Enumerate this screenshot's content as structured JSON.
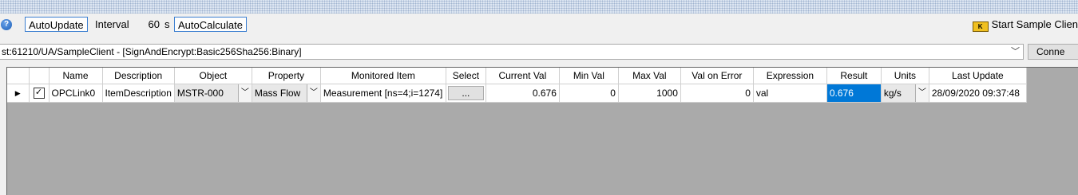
{
  "toolbar": {
    "help_icon": "?",
    "auto_update_label": "AutoUpdate",
    "interval_label": "Interval",
    "interval_value": "60",
    "interval_unit": "s",
    "auto_calculate_label": "AutoCalculate",
    "start_icon_glyph": "K",
    "start_sample_client_label": "Start Sample Clien"
  },
  "endpoint": {
    "value": "st:61210/UA/SampleClient - [SignAndEncrypt:Basic256Sha256:Binary]",
    "arrow": "﹀",
    "connect_label": "Conne"
  },
  "grid": {
    "columns": [
      "Name",
      "Description",
      "Object",
      "Property",
      "Monitored Item",
      "Select",
      "Current Val",
      "Min Val",
      "Max Val",
      "Val on Error",
      "Expression",
      "Result",
      "Units",
      "Last Update"
    ],
    "rows": [
      {
        "row_indicator": "▶",
        "checked": "✓",
        "name": "OPCLink0",
        "description": "ItemDescription",
        "object": "MSTR-000",
        "property": "Mass Flow",
        "monitored_item": "Measurement [ns=4;i=1274]",
        "select": "...",
        "current_val": "0.676",
        "min_val": "0",
        "max_val": "1000",
        "val_on_error": "0",
        "expression": "val",
        "result": "0.676",
        "units": "kg/s",
        "last_update": "28/09/2020 09:37:48",
        "dropdown_arrow": "﹀"
      }
    ]
  }
}
